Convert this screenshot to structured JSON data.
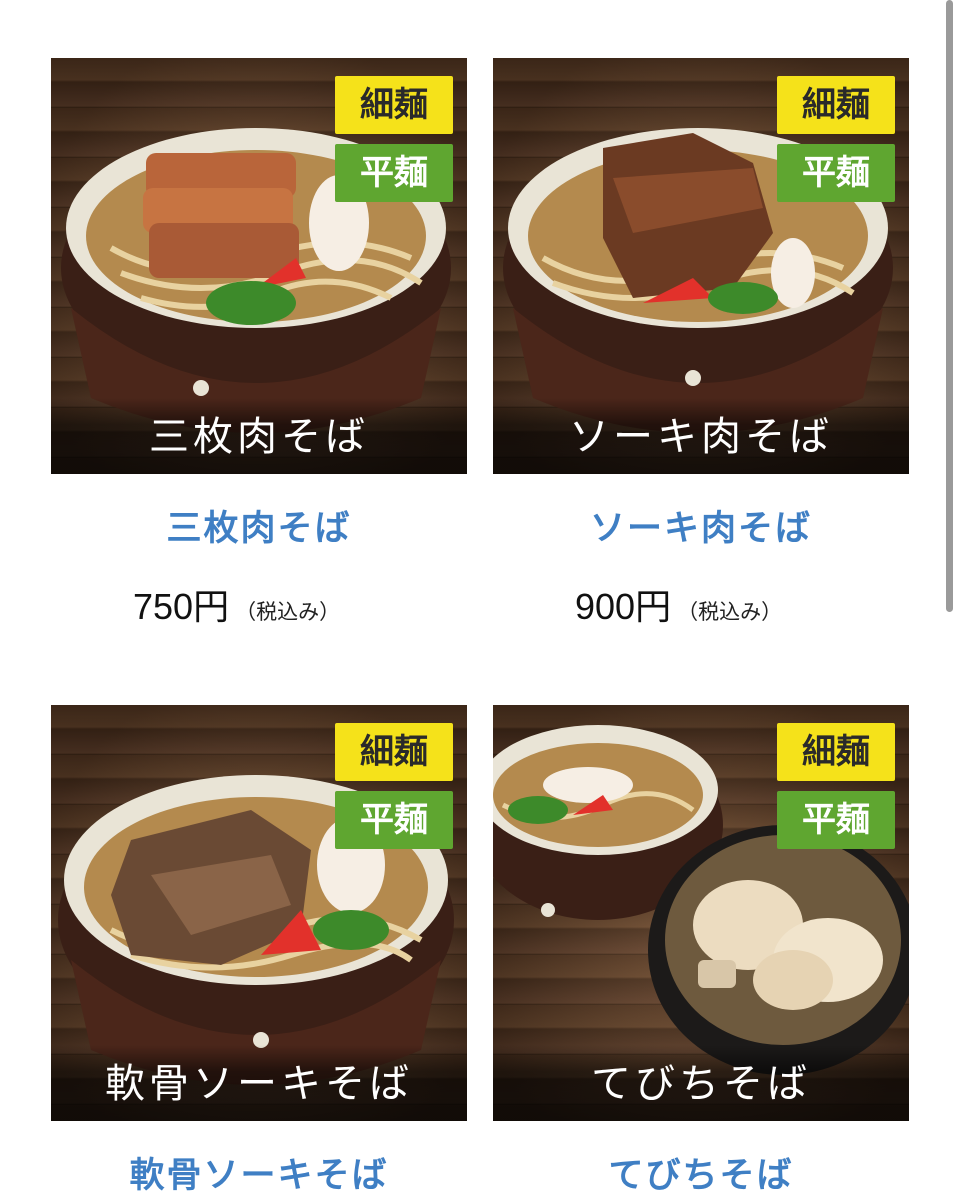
{
  "colors": {
    "accent_name": "#3f7fc4",
    "badge_thin_bg": "#f5e21a",
    "badge_flat_bg": "#5fa630"
  },
  "menu": [
    {
      "caption": "三枚肉そば",
      "badges": {
        "thin": "細麺",
        "flat": "平麺"
      },
      "name": "三枚肉そば",
      "price": "750円",
      "tax_note": "（税込み）"
    },
    {
      "caption": "ソーキ肉そば",
      "badges": {
        "thin": "細麺",
        "flat": "平麺"
      },
      "name": "ソーキ肉そば",
      "price": "900円",
      "tax_note": "（税込み）"
    },
    {
      "caption": "軟骨ソーキそば",
      "badges": {
        "thin": "細麺",
        "flat": "平麺"
      },
      "name": "軟骨ソーキそば"
    },
    {
      "caption": "てびちそば",
      "badges": {
        "thin": "細麺",
        "flat": "平麺"
      },
      "name": "てびちそば"
    }
  ]
}
